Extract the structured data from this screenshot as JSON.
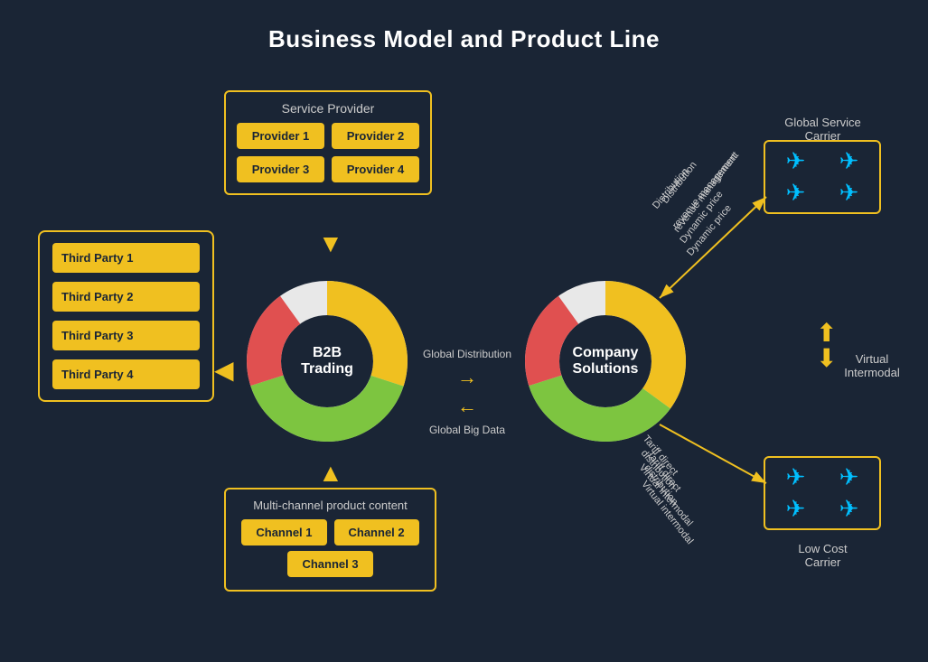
{
  "title": "Business Model and Product Line",
  "service_provider": {
    "label": "Service Provider",
    "providers": [
      "Provider 1",
      "Provider 2",
      "Provider 3",
      "Provider 4"
    ]
  },
  "third_parties": {
    "items": [
      "Third Party 1",
      "Third Party 2",
      "Third Party 3",
      "Third Party 4"
    ]
  },
  "multichannel": {
    "label": "Multi-channel product content",
    "channels": [
      "Channel 1",
      "Channel 2",
      "Channel 3"
    ]
  },
  "b2b": {
    "label": "B2B\nTrading"
  },
  "company": {
    "label": "Company\nSolutions"
  },
  "arrows": {
    "global_distribution": "Global Distribution",
    "global_big_data": "Global Big Data"
  },
  "global_service_carrier": {
    "label": "Global Service\nCarrier"
  },
  "low_cost_carrier": {
    "label": "Low Cost\nCarrier"
  },
  "virtual_intermodal": {
    "label": "Virtual\nIntermodal"
  },
  "diag_labels": {
    "distribution": "Distribution",
    "revenue_management": "revenue management",
    "dynamic_price": "Dynamic price",
    "tariff_direct": "Tariff direct",
    "distribution2": "distribution",
    "virtual_intermodal2": "Virtual intermodal"
  },
  "colors": {
    "gold": "#f0c020",
    "background": "#1a2535",
    "plane": "#00bfff"
  }
}
